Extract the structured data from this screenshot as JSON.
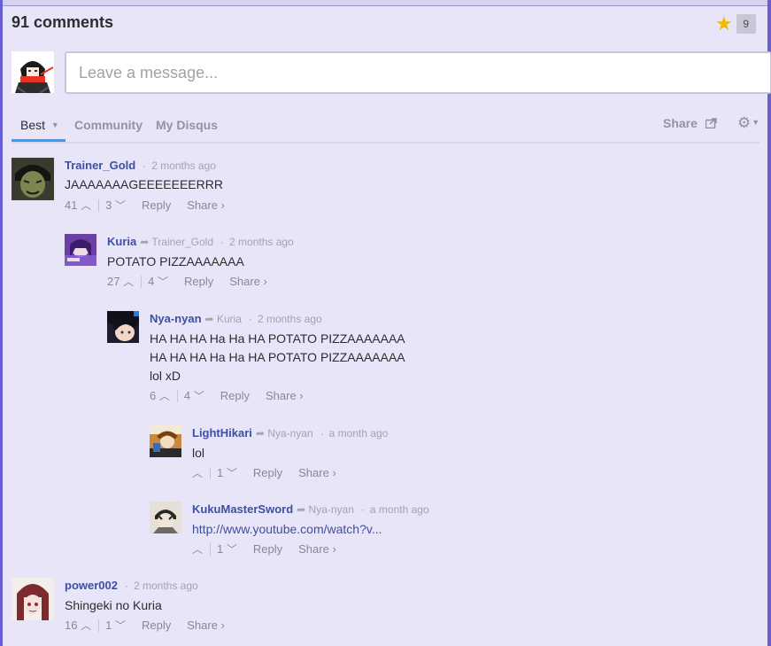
{
  "header": {
    "comment_count": "91 comments",
    "star_count": "9"
  },
  "composer": {
    "placeholder": "Leave a message..."
  },
  "nav": {
    "tabs": [
      "Best",
      "Community",
      "My Disqus"
    ],
    "share": "Share"
  },
  "labels": {
    "reply": "Reply",
    "share": "Share ›"
  },
  "comments": [
    {
      "author": "Trainer_Gold",
      "time": "2 months ago",
      "lines": [
        "JAAAAAAAGEEEEEEERRR"
      ],
      "up": "41",
      "down": "3"
    },
    {
      "author": "Kuria",
      "parent": "Trainer_Gold",
      "time": "2 months ago",
      "lines": [
        "POTATO PIZZAAAAAAA"
      ],
      "up": "27",
      "down": "4"
    },
    {
      "author": "Nya-nyan",
      "parent": "Kuria",
      "time": "2 months ago",
      "lines": [
        "HA HA HA Ha Ha HA POTATO PIZZAAAAAAA",
        "HA HA HA Ha Ha HA POTATO PIZZAAAAAAA",
        "lol xD"
      ],
      "up": "6",
      "down": "4"
    },
    {
      "author": "LightHikari",
      "parent": "Nya-nyan",
      "time": "a month ago",
      "lines": [
        "lol"
      ],
      "up": "",
      "down": "1"
    },
    {
      "author": "KukuMasterSword",
      "parent": "Nya-nyan",
      "time": "a month ago",
      "link": "http://www.youtube.com/watch?v...",
      "up": "",
      "down": "1"
    },
    {
      "author": "power002",
      "time": "2 months ago",
      "lines": [
        "Shingeki no Kuria"
      ],
      "up": "16",
      "down": "1"
    }
  ]
}
